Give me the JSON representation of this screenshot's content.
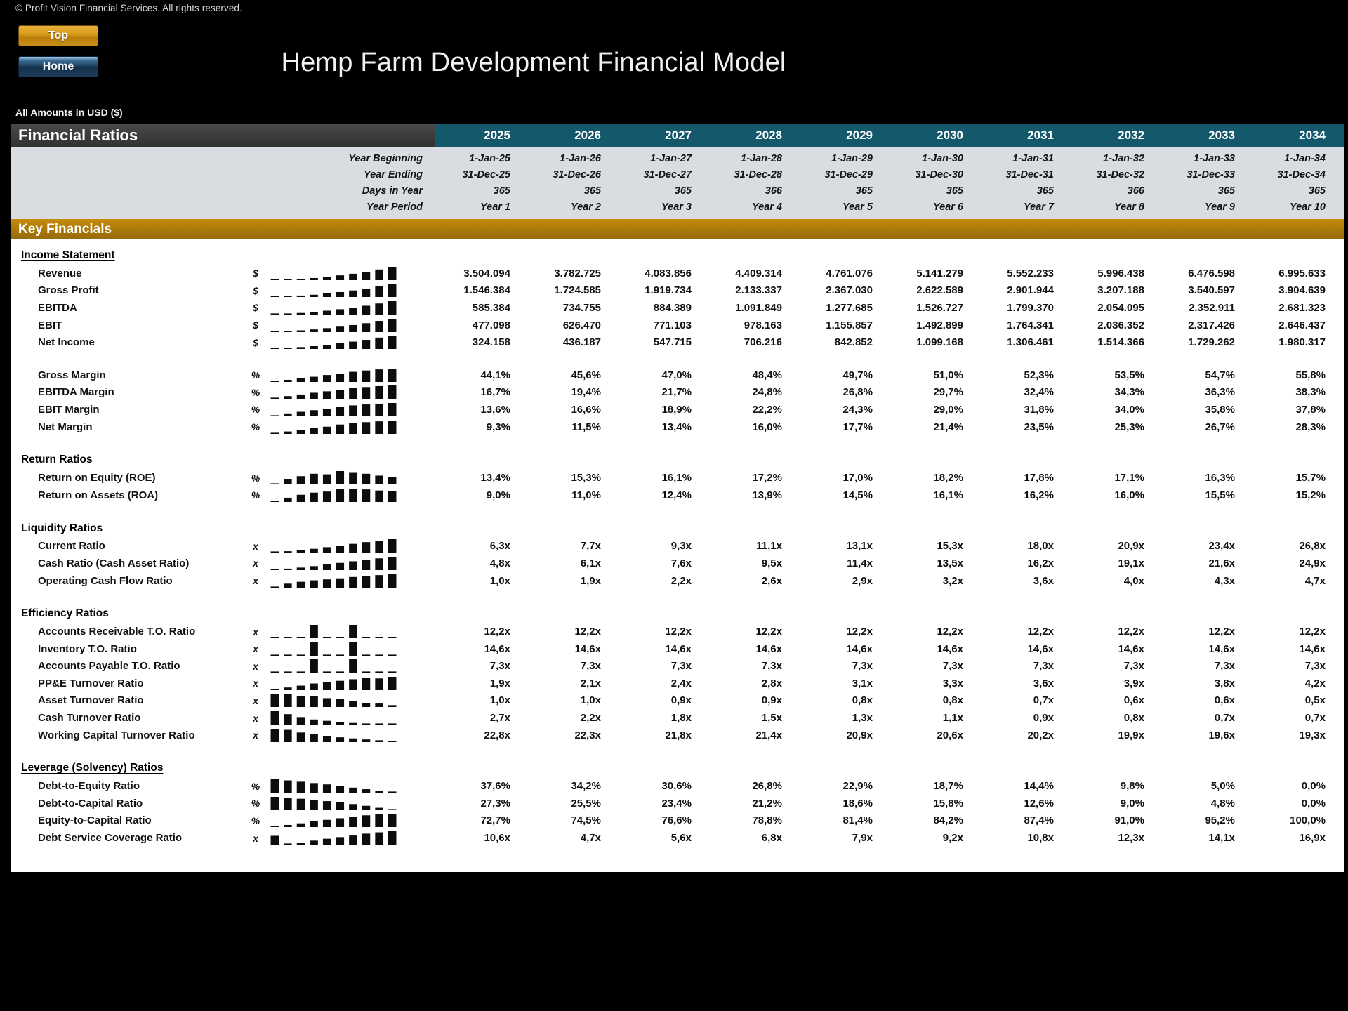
{
  "meta": {
    "copyright": "© Profit Vision Financial Services. All rights reserved.",
    "title": "Hemp Farm Development Financial Model",
    "units_note": "All Amounts in  USD ($)",
    "nav": {
      "top_label": "Top",
      "home_label": "Home"
    },
    "accent_teal": "#14586b",
    "accent_gold": "#b07d08",
    "header_grey": "#3c3c3c",
    "meta_band": "#d9dde2"
  },
  "section_title": "Financial Ratios",
  "key_financials_banner": "Key Financials",
  "columns": {
    "years": [
      "2025",
      "2026",
      "2027",
      "2028",
      "2029",
      "2030",
      "2031",
      "2032",
      "2033",
      "2034"
    ],
    "row_labels": {
      "year_beginning": "Year Beginning",
      "year_ending": "Year Ending",
      "days_in_year": "Days in Year",
      "year_period": "Year Period"
    },
    "year_beginning": [
      "1-Jan-25",
      "1-Jan-26",
      "1-Jan-27",
      "1-Jan-28",
      "1-Jan-29",
      "1-Jan-30",
      "1-Jan-31",
      "1-Jan-32",
      "1-Jan-33",
      "1-Jan-34"
    ],
    "year_ending": [
      "31-Dec-25",
      "31-Dec-26",
      "31-Dec-27",
      "31-Dec-28",
      "31-Dec-29",
      "31-Dec-30",
      "31-Dec-31",
      "31-Dec-32",
      "31-Dec-33",
      "31-Dec-34"
    ],
    "days_in_year": [
      "365",
      "365",
      "365",
      "366",
      "365",
      "365",
      "365",
      "366",
      "365",
      "365"
    ],
    "year_period": [
      "Year 1",
      "Year 2",
      "Year 3",
      "Year 4",
      "Year 5",
      "Year 6",
      "Year 7",
      "Year 8",
      "Year 9",
      "Year 10"
    ]
  },
  "sections": [
    {
      "name": "Income Statement",
      "rows": [
        {
          "label": "Revenue",
          "unit": "$",
          "spark": [
            4,
            5,
            10,
            16,
            26,
            36,
            48,
            62,
            80,
            100
          ],
          "values": [
            "3.504.094",
            "3.782.725",
            "4.083.856",
            "4.409.314",
            "4.761.076",
            "5.141.279",
            "5.552.233",
            "5.996.438",
            "6.476.598",
            "6.995.633"
          ]
        },
        {
          "label": "Gross Profit",
          "unit": "$",
          "spark": [
            4,
            6,
            11,
            17,
            27,
            37,
            49,
            63,
            81,
            100
          ],
          "values": [
            "1.546.384",
            "1.724.585",
            "1.919.734",
            "2.133.337",
            "2.367.030",
            "2.622.589",
            "2.901.944",
            "3.207.188",
            "3.540.597",
            "3.904.639"
          ]
        },
        {
          "label": "EBITDA",
          "unit": "$",
          "spark": [
            4,
            7,
            12,
            19,
            29,
            40,
            52,
            66,
            83,
            100
          ],
          "values": [
            "585.384",
            "734.755",
            "884.389",
            "1.091.849",
            "1.277.685",
            "1.526.727",
            "1.799.370",
            "2.054.095",
            "2.352.911",
            "2.681.323"
          ]
        },
        {
          "label": "EBIT",
          "unit": "$",
          "spark": [
            4,
            8,
            13,
            20,
            30,
            41,
            53,
            67,
            84,
            100
          ],
          "values": [
            "477.098",
            "626.470",
            "771.103",
            "978.163",
            "1.155.857",
            "1.492.899",
            "1.764.341",
            "2.036.352",
            "2.317.426",
            "2.646.437"
          ]
        },
        {
          "label": "Net Income",
          "unit": "$",
          "spark": [
            4,
            8,
            14,
            21,
            31,
            43,
            55,
            68,
            85,
            100
          ],
          "values": [
            "324.158",
            "436.187",
            "547.715",
            "706.216",
            "842.852",
            "1.099.168",
            "1.306.461",
            "1.514.366",
            "1.729.262",
            "1.980.317"
          ]
        }
      ]
    },
    {
      "name": "",
      "rows": [
        {
          "label": "Gross Margin",
          "unit": "%",
          "spark": [
            5,
            16,
            28,
            39,
            52,
            63,
            76,
            86,
            94,
            100
          ],
          "values": [
            "44,1%",
            "45,6%",
            "47,0%",
            "48,4%",
            "49,7%",
            "51,0%",
            "52,3%",
            "53,5%",
            "54,7%",
            "55,8%"
          ]
        },
        {
          "label": "EBITDA Margin",
          "unit": "%",
          "spark": [
            5,
            20,
            32,
            45,
            56,
            68,
            80,
            88,
            95,
            100
          ],
          "values": [
            "16,7%",
            "19,4%",
            "21,7%",
            "24,8%",
            "26,8%",
            "29,7%",
            "32,4%",
            "34,3%",
            "36,3%",
            "38,3%"
          ]
        },
        {
          "label": "EBIT Margin",
          "unit": "%",
          "spark": [
            5,
            22,
            34,
            46,
            57,
            72,
            82,
            89,
            95,
            100
          ],
          "values": [
            "13,6%",
            "16,6%",
            "18,9%",
            "22,2%",
            "24,3%",
            "29,0%",
            "31,8%",
            "34,0%",
            "35,8%",
            "37,8%"
          ]
        },
        {
          "label": "Net Margin",
          "unit": "%",
          "spark": [
            5,
            18,
            30,
            44,
            54,
            70,
            80,
            88,
            94,
            100
          ],
          "values": [
            "9,3%",
            "11,5%",
            "13,4%",
            "16,0%",
            "17,7%",
            "21,4%",
            "23,5%",
            "25,3%",
            "26,7%",
            "28,3%"
          ]
        }
      ]
    },
    {
      "name": "Return Ratios",
      "rows": [
        {
          "label": "Return on Equity (ROE)",
          "unit": "%",
          "spark": [
            6,
            42,
            62,
            80,
            76,
            100,
            92,
            80,
            66,
            56
          ],
          "values": [
            "13,4%",
            "15,3%",
            "16,1%",
            "17,2%",
            "17,0%",
            "18,2%",
            "17,8%",
            "17,1%",
            "16,3%",
            "15,7%"
          ]
        },
        {
          "label": "Return on Assets (ROA)",
          "unit": "%",
          "spark": [
            6,
            32,
            54,
            70,
            78,
            96,
            100,
            94,
            86,
            80
          ],
          "values": [
            "9,0%",
            "11,0%",
            "12,4%",
            "13,9%",
            "14,5%",
            "16,1%",
            "16,2%",
            "16,0%",
            "15,5%",
            "15,2%"
          ]
        }
      ]
    },
    {
      "name": "Liquidity Ratios",
      "rows": [
        {
          "label": "Current Ratio",
          "unit": "x",
          "spark": [
            4,
            10,
            18,
            28,
            40,
            52,
            65,
            78,
            89,
            100
          ],
          "values": [
            "6,3x",
            "7,7x",
            "9,3x",
            "11,1x",
            "13,1x",
            "15,3x",
            "18,0x",
            "20,9x",
            "23,4x",
            "26,8x"
          ]
        },
        {
          "label": "Cash Ratio (Cash Asset Ratio)",
          "unit": "x",
          "spark": [
            4,
            11,
            19,
            30,
            42,
            54,
            66,
            78,
            88,
            100
          ],
          "values": [
            "4,8x",
            "6,1x",
            "7,6x",
            "9,5x",
            "11,4x",
            "13,5x",
            "16,2x",
            "19,1x",
            "21,6x",
            "24,9x"
          ]
        },
        {
          "label": "Operating Cash Flow Ratio",
          "unit": "x",
          "spark": [
            5,
            30,
            44,
            55,
            62,
            70,
            80,
            88,
            94,
            100
          ],
          "values": [
            "1,0x",
            "1,9x",
            "2,2x",
            "2,6x",
            "2,9x",
            "3,2x",
            "3,6x",
            "4,0x",
            "4,3x",
            "4,7x"
          ]
        }
      ]
    },
    {
      "name": "Efficiency Ratios",
      "rows": [
        {
          "label": "Accounts Receivable T.O. Ratio",
          "unit": "x",
          "spark": [
            3,
            3,
            3,
            100,
            3,
            3,
            100,
            3,
            3,
            3
          ],
          "values": [
            "12,2x",
            "12,2x",
            "12,2x",
            "12,2x",
            "12,2x",
            "12,2x",
            "12,2x",
            "12,2x",
            "12,2x",
            "12,2x"
          ]
        },
        {
          "label": "Inventory T.O. Ratio",
          "unit": "x",
          "spark": [
            3,
            3,
            3,
            100,
            3,
            3,
            100,
            3,
            3,
            3
          ],
          "values": [
            "14,6x",
            "14,6x",
            "14,6x",
            "14,6x",
            "14,6x",
            "14,6x",
            "14,6x",
            "14,6x",
            "14,6x",
            "14,6x"
          ]
        },
        {
          "label": "Accounts Payable T.O. Ratio",
          "unit": "x",
          "spark": [
            3,
            3,
            3,
            100,
            3,
            3,
            100,
            3,
            3,
            3
          ],
          "values": [
            "7,3x",
            "7,3x",
            "7,3x",
            "7,3x",
            "7,3x",
            "7,3x",
            "7,3x",
            "7,3x",
            "7,3x",
            "7,3x"
          ]
        },
        {
          "label": "PP&E Turnover Ratio",
          "unit": "x",
          "spark": [
            6,
            20,
            34,
            50,
            62,
            70,
            82,
            92,
            88,
            100
          ],
          "values": [
            "1,9x",
            "2,1x",
            "2,4x",
            "2,8x",
            "3,1x",
            "3,3x",
            "3,6x",
            "3,9x",
            "3,8x",
            "4,2x"
          ]
        },
        {
          "label": "Asset Turnover Ratio",
          "unit": "x",
          "spark": [
            100,
            98,
            84,
            80,
            66,
            60,
            42,
            30,
            26,
            14
          ],
          "values": [
            "1,0x",
            "1,0x",
            "0,9x",
            "0,9x",
            "0,8x",
            "0,8x",
            "0,7x",
            "0,6x",
            "0,6x",
            "0,5x"
          ]
        },
        {
          "label": "Cash Turnover Ratio",
          "unit": "x",
          "spark": [
            100,
            78,
            56,
            38,
            28,
            20,
            12,
            8,
            6,
            5
          ],
          "values": [
            "2,7x",
            "2,2x",
            "1,8x",
            "1,5x",
            "1,3x",
            "1,1x",
            "0,9x",
            "0,8x",
            "0,7x",
            "0,7x"
          ]
        },
        {
          "label": "Working Capital Turnover Ratio",
          "unit": "x",
          "spark": [
            100,
            92,
            72,
            62,
            44,
            36,
            28,
            20,
            14,
            8
          ],
          "values": [
            "22,8x",
            "22,3x",
            "21,8x",
            "21,4x",
            "20,9x",
            "20,6x",
            "20,2x",
            "19,9x",
            "19,6x",
            "19,3x"
          ]
        }
      ]
    },
    {
      "name": "Leverage (Solvency) Ratios",
      "rows": [
        {
          "label": "Debt-to-Equity Ratio",
          "unit": "%",
          "spark": [
            100,
            92,
            82,
            72,
            62,
            50,
            38,
            26,
            14,
            4
          ],
          "values": [
            "37,6%",
            "34,2%",
            "30,6%",
            "26,8%",
            "22,9%",
            "18,7%",
            "14,4%",
            "9,8%",
            "5,0%",
            "0,0%"
          ]
        },
        {
          "label": "Debt-to-Capital Ratio",
          "unit": "%",
          "spark": [
            100,
            94,
            86,
            78,
            68,
            58,
            46,
            33,
            18,
            4
          ],
          "values": [
            "27,3%",
            "25,5%",
            "23,4%",
            "21,2%",
            "18,6%",
            "15,8%",
            "12,6%",
            "9,0%",
            "4,8%",
            "0,0%"
          ]
        },
        {
          "label": "Equity-to-Capital Ratio",
          "unit": "%",
          "spark": [
            4,
            16,
            28,
            42,
            54,
            66,
            78,
            88,
            95,
            100
          ],
          "values": [
            "72,7%",
            "74,5%",
            "76,6%",
            "78,8%",
            "81,4%",
            "84,2%",
            "87,4%",
            "91,0%",
            "95,2%",
            "100,0%"
          ]
        },
        {
          "label": "Debt Service Coverage Ratio",
          "unit": "x",
          "spark": [
            66,
            6,
            14,
            30,
            44,
            56,
            68,
            82,
            92,
            100
          ],
          "values": [
            "10,6x",
            "4,7x",
            "5,6x",
            "6,8x",
            "7,9x",
            "9,2x",
            "10,8x",
            "12,3x",
            "14,1x",
            "16,9x"
          ]
        }
      ]
    }
  ]
}
